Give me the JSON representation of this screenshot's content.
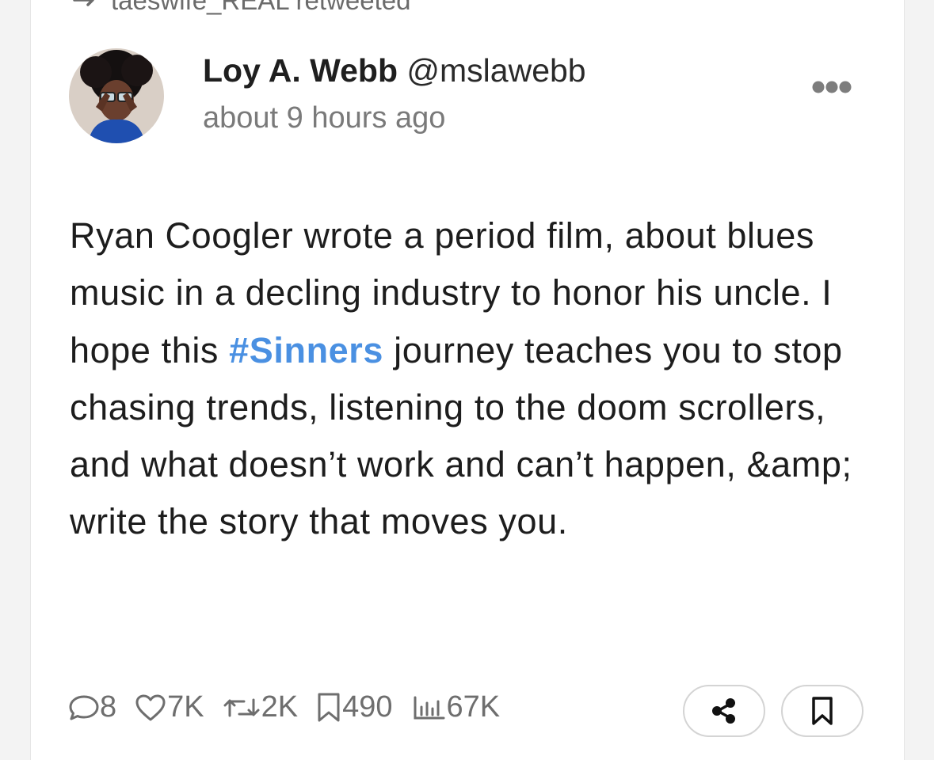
{
  "retweet": {
    "text": "taeswife_REAL retweeted",
    "icon": "retweet-icon"
  },
  "author": {
    "name": "Loy A. Webb",
    "handle": "@mslawebb",
    "timestamp": "about 9 hours ago"
  },
  "tweet": {
    "text_before": "Ryan Coogler wrote a period film, about blues music in a decling industry to honor his uncle. I hope this ",
    "hashtag": "#Sinners",
    "text_after": " journey teaches you to stop chasing trends, listening to the doom scrollers, and what doesn’t work and can’t happen, &amp; write the story that moves you."
  },
  "stats": {
    "replies": "8",
    "likes": "7K",
    "retweets": "2K",
    "bookmarks": "490",
    "views": "67K"
  },
  "icons": {
    "more": "more-horizontal-icon",
    "reply": "comment-icon",
    "like": "heart-icon",
    "retweet": "retweet-icon",
    "bookmark": "bookmark-icon",
    "views": "bar-chart-icon",
    "share": "share-icon"
  },
  "colors": {
    "hashtag": "#4a90e2",
    "text": "#1d1d1d",
    "muted": "#7a7a7a"
  }
}
